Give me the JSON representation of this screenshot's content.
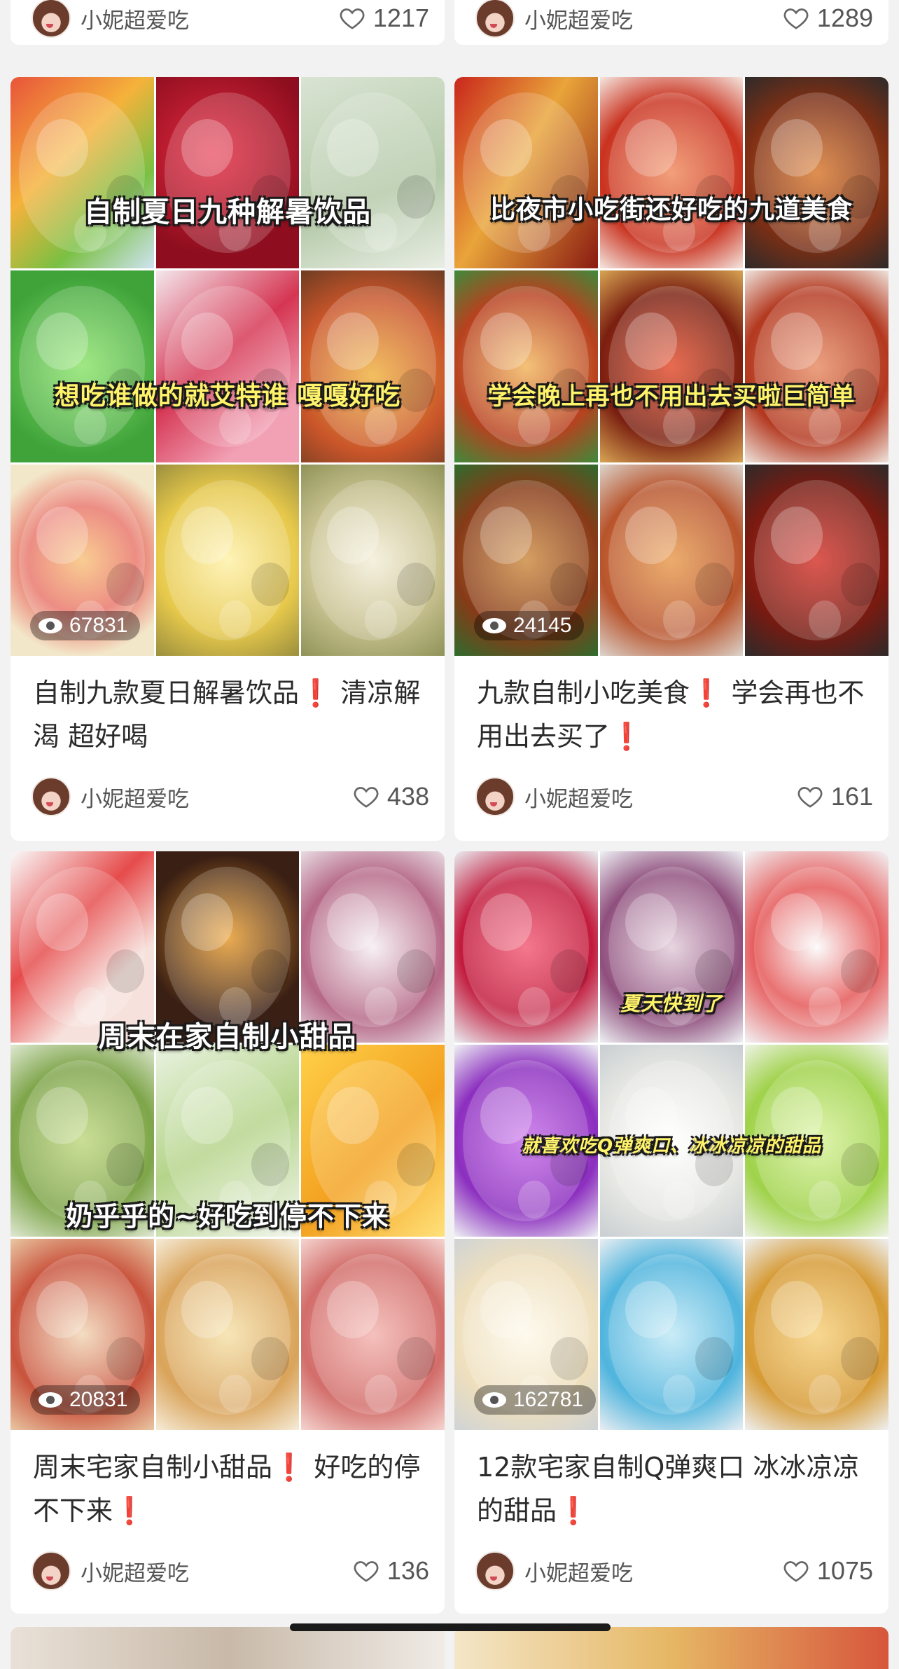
{
  "feed": {
    "top_row": [
      {
        "author": "小妮超爱吃",
        "likes": "1217"
      },
      {
        "author": "小妮超爱吃",
        "likes": "1289"
      }
    ],
    "cards": [
      {
        "captions": [
          "自制夏日九种解暑饮品",
          "想吃谁做的就艾特谁 嘎嘎好吃"
        ],
        "views": "67831",
        "title_parts": [
          "自制九款夏日解暑饮品",
          "❗",
          " 清凉解渴 超好喝"
        ],
        "author": "小妮超爱吃",
        "likes": "438"
      },
      {
        "captions": [
          "比夜市小吃街还好吃的九道美食",
          "学会晚上再也不用出去买啦巨简单"
        ],
        "views": "24145",
        "title_parts": [
          "九款自制小吃美食",
          "❗",
          " 学会再也不用出去买了",
          "❗"
        ],
        "author": "小妮超爱吃",
        "likes": "161"
      },
      {
        "captions": [
          "周末在家自制小甜品",
          "奶乎乎的~好吃到停不下来"
        ],
        "views": "20831",
        "title_parts": [
          "周末宅家自制小甜品",
          "❗",
          " 好吃的停不下来",
          "❗"
        ],
        "author": "小妮超爱吃",
        "likes": "136"
      },
      {
        "captions": [
          "夏天快到了",
          "就喜欢吃Q弹爽口、冰冰凉凉的甜品"
        ],
        "views": "162781",
        "title_parts": [
          "12款宅家自制Q弹爽口 冰冰凉凉的甜品",
          "❗"
        ],
        "author": "小妮超爱吃",
        "likes": "1075"
      }
    ]
  },
  "icons": {
    "views": "eye-icon",
    "likes": "heart-outline-icon",
    "alert": "red-exclamation-icon"
  },
  "colors": {
    "background": "#f2f2f2",
    "card": "#ffffff",
    "text": "#2b2b2b",
    "meta_text": "#555555",
    "alert_red": "#e3262d",
    "caption_yellow": "#fff36a"
  }
}
